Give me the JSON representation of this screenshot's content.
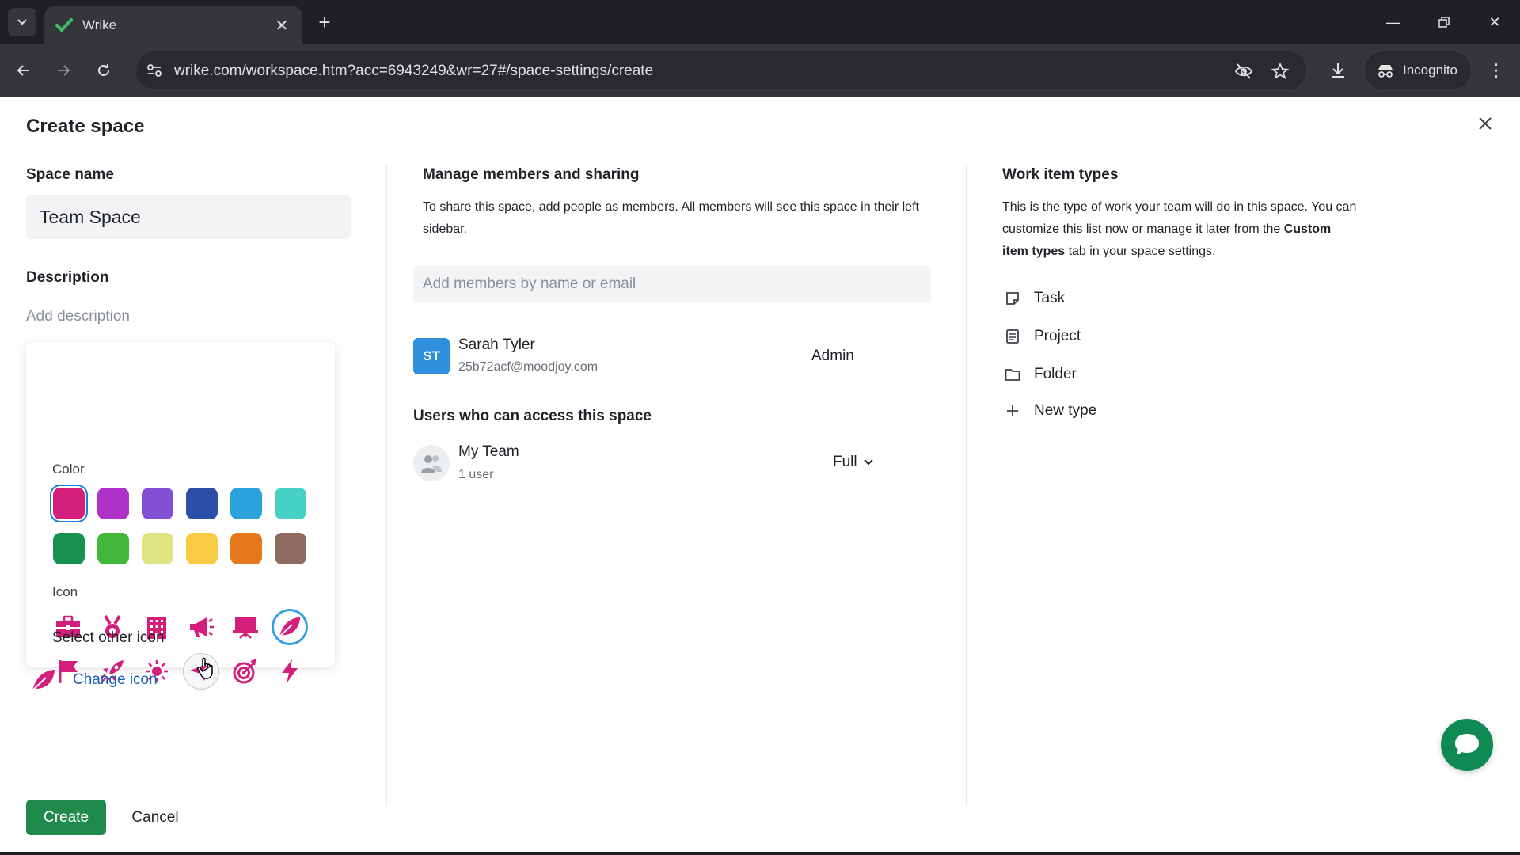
{
  "browser": {
    "tab_title": "Wrike",
    "url": "wrike.com/workspace.htm?acc=6943249&wr=27#/space-settings/create",
    "incognito_label": "Incognito"
  },
  "dialog": {
    "title": "Create space",
    "space_name_label": "Space name",
    "space_name_value": "Team Space",
    "description_label": "Description",
    "description_placeholder": "Add description",
    "picker": {
      "color_label": "Color",
      "colors": [
        "#d41e7c",
        "#b033c9",
        "#8150d4",
        "#2b4ea8",
        "#2ba2dc",
        "#45d1c4",
        "#16914f",
        "#43b73a",
        "#dfe382",
        "#f9cb45",
        "#e5781b",
        "#8e6a60"
      ],
      "selected_color": "#d41e7c",
      "icon_label": "Icon",
      "icons": [
        "briefcase-icon",
        "medal-icon",
        "building-icon",
        "megaphone-icon",
        "presentation-icon",
        "leaf-icon",
        "flag-icon",
        "rocket-icon",
        "sun-icon",
        "paper-plane-icon",
        "target-icon",
        "lightning-icon"
      ],
      "selected_icon": "leaf-icon",
      "select_other_label": "Select other icon"
    },
    "change_icon_label": "Change icon",
    "members": {
      "title": "Manage members and sharing",
      "description": "To share this space, add people as members. All members will see this space in their left sidebar.",
      "input_placeholder": "Add members by name or email",
      "list": [
        {
          "initials": "ST",
          "name": "Sarah Tyler",
          "email": "25b72acf@moodjoy.com",
          "role": "Admin"
        }
      ],
      "access_title": "Users who can access this space",
      "groups": [
        {
          "name": "My Team",
          "count": "1 user",
          "access": "Full"
        }
      ]
    },
    "work_types": {
      "title": "Work item types",
      "description_pre": "This is the type of work your team will do in this space. You can customize this list now or manage it later from the ",
      "description_bold": "Custom item types",
      "description_post": " tab in your space settings.",
      "items": [
        "Task",
        "Project",
        "Folder"
      ],
      "new_type_label": "New type"
    },
    "footer": {
      "create_label": "Create",
      "cancel_label": "Cancel"
    }
  }
}
